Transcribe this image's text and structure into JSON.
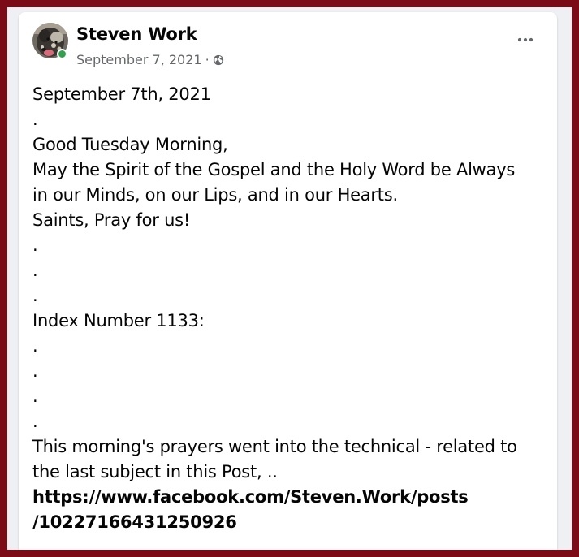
{
  "post": {
    "author": "Steven Work",
    "date": "September 7, 2021",
    "separator": "·",
    "privacy_icon": "globe-icon",
    "more_icon": "more-options-icon",
    "online_status": "online",
    "colors": {
      "online": "#31a24c",
      "frame": "#7b0c17",
      "meta_text": "#65676b"
    },
    "lines": [
      "September 7th, 2021",
      ".",
      "Good Tuesday Morning,",
      "May the Spirit of the Gospel and the Holy Word be Always",
      "in our Minds, on our Lips, and in our Hearts.",
      "Saints, Pray for us!",
      ".",
      ".",
      ".",
      "Index Number 1133:",
      ".",
      ".",
      ".",
      ".",
      "This morning's prayers went into the technical - related to",
      "the last subject in this Post, .."
    ],
    "link_lines": [
      "https://www.facebook.com/Steven.Work/posts",
      "/10227166431250926"
    ]
  }
}
